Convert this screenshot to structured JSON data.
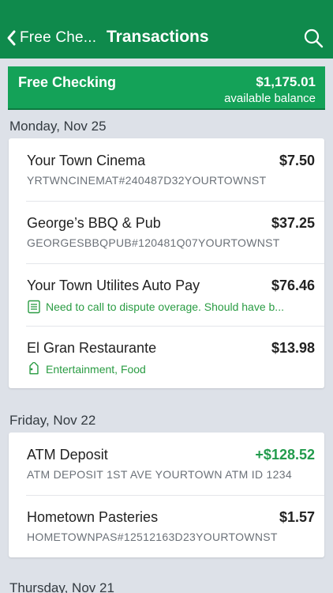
{
  "nav": {
    "back_label": "Free Che...",
    "title": "Transactions"
  },
  "account": {
    "name": "Free Checking",
    "balance": "$1,175.01",
    "balance_label": "available balance"
  },
  "days": [
    {
      "label": "Monday, Nov 25",
      "transactions": [
        {
          "name": "Your Town Cinema",
          "amount": "$7.50",
          "detail": "YRTWNCINEMAT#240487D32YOURTOWNST"
        },
        {
          "name": "George’s BBQ & Pub",
          "amount": "$37.25",
          "detail": "GEORGESBBQPUB#120481Q07YOURTOWNST"
        },
        {
          "name": "Your Town Utilites Auto Pay",
          "amount": "$76.46",
          "note": "Need to call to dispute overage. Should have b..."
        },
        {
          "name": "El Gran Restaurante",
          "amount": "$13.98",
          "tags": "Entertainment, Food"
        }
      ]
    },
    {
      "label": "Friday, Nov 22",
      "transactions": [
        {
          "name": "ATM Deposit",
          "amount": "+$128.52",
          "detail": "ATM DEPOSIT 1ST AVE YOURTOWN ATM ID 1234"
        },
        {
          "name": "Hometown Pasteries",
          "amount": "$1.57",
          "detail": "HOMETOWNPAS#12512163D23YOURTOWNST"
        }
      ]
    },
    {
      "label": "Thursday, Nov 21"
    }
  ],
  "colors": {
    "header": "#0f8a4c",
    "account_bar": "#14a258",
    "positive": "#229b4c",
    "note": "#2a9c43"
  },
  "icons": {
    "back": "chevron-left-icon",
    "search": "search-icon",
    "note": "note-icon",
    "tag": "tag-icon"
  }
}
